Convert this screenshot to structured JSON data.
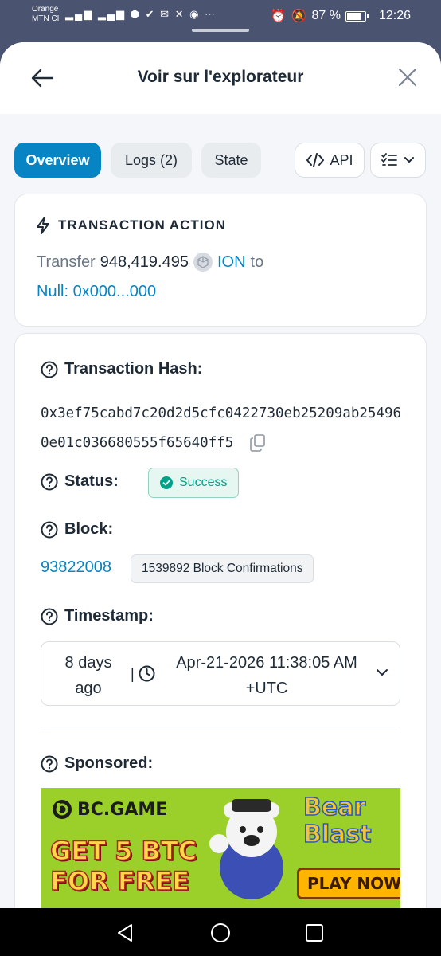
{
  "status_bar": {
    "carrier_line1": "Orange",
    "carrier_line2": "MTN CI",
    "signal_icons": "⁴⁶ᵢₗₗ ⁴⁶ᵢₗₗ",
    "battery_percent": "87 %",
    "battery_level": 0.87,
    "time": "12:26"
  },
  "header": {
    "title": "Voir sur l'explorateur"
  },
  "tabs": {
    "overview": "Overview",
    "logs": "Logs (2)",
    "state": "State",
    "api": "API"
  },
  "action": {
    "heading": "TRANSACTION ACTION",
    "verb": "Transfer",
    "amount": "948,419.495",
    "token": "ION",
    "preposition": "to",
    "recipient": "Null: 0x000...000"
  },
  "details": {
    "hash_label": "Transaction Hash:",
    "hash_value": "0x3ef75cabd7c20d2d5cfc0422730eb25209ab254960e01c036680555f65640ff5",
    "status_label": "Status:",
    "status_value": "Success",
    "block_label": "Block:",
    "block_number": "93822008",
    "block_confirmations": "1539892 Block Confirmations",
    "timestamp_label": "Timestamp:",
    "timestamp_ago": "8 days ago",
    "timestamp_date": "Apr-21-2026 11:38:05 AM +UTC",
    "sponsored_label": "Sponsored:"
  },
  "ad": {
    "brand": "BC.GAME",
    "promo": "GET 5 BTC FOR FREE",
    "game": "Bear Blast",
    "cta": "PLAY NOW"
  },
  "colors": {
    "accent": "#0784c3",
    "success": "#00a186",
    "sheet_bg": "#f4f6f9"
  }
}
